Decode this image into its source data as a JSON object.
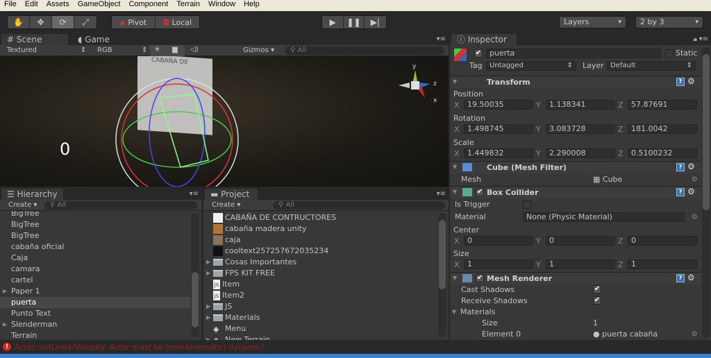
{
  "menu": [
    "File",
    "Edit",
    "Assets",
    "GameObject",
    "Component",
    "Terrain",
    "Window",
    "Help"
  ],
  "toolbar": {
    "tools": [
      "hand-icon",
      "move-icon",
      "rotate-icon",
      "scale-icon"
    ],
    "selected_tool": "rotate-icon",
    "pivot": "Pivot",
    "local": "Local",
    "layers": "Layers",
    "layout": "2 by 3"
  },
  "scene": {
    "tabs": [
      "Scene",
      "Game"
    ],
    "render_mode": "Textured",
    "color_mode": "RGB",
    "gizmos": "Gizmos",
    "search": "All",
    "overlay_text": "0",
    "sign_text": "CABAÑA DE",
    "gizmo_axes": [
      "y",
      "z",
      "x"
    ]
  },
  "hierarchy": {
    "tab": "Hierarchy",
    "create": "Create",
    "search": "All",
    "items": [
      {
        "label": "BigTree",
        "arrow": false
      },
      {
        "label": "BigTree",
        "arrow": false
      },
      {
        "label": "BigTree",
        "arrow": false
      },
      {
        "label": "cabaña oficial",
        "arrow": false
      },
      {
        "label": "Caja",
        "arrow": false
      },
      {
        "label": "camara",
        "arrow": false
      },
      {
        "label": "cartel",
        "arrow": false
      },
      {
        "label": "Paper 1",
        "arrow": true
      },
      {
        "label": "puerta",
        "arrow": false,
        "selected": true
      },
      {
        "label": "Punto Text",
        "arrow": false
      },
      {
        "label": "Slenderman",
        "arrow": true
      },
      {
        "label": "Terrain",
        "arrow": false
      }
    ]
  },
  "project": {
    "tab": "Project",
    "create": "Create",
    "search": "All",
    "items": [
      {
        "label": "CABAÑA DE CONTRUCTORES",
        "icon": "texture-icon",
        "color": "#f0f0f0"
      },
      {
        "label": "cabaña madera unity",
        "icon": "texture-icon",
        "color": "#b87333"
      },
      {
        "label": "caja",
        "icon": "texture-icon",
        "color": "#8b7355"
      },
      {
        "label": "cooltext257257672035234",
        "icon": "texture-icon",
        "color": "#111111"
      },
      {
        "label": "Cosas Importantes",
        "icon": "folder-icon",
        "arrow": true
      },
      {
        "label": "FPS KIT FREE",
        "icon": "folder-icon",
        "arrow": true
      },
      {
        "label": "Item",
        "icon": "js-script-icon"
      },
      {
        "label": "Item2",
        "icon": "js-script-icon"
      },
      {
        "label": "JS",
        "icon": "folder-icon",
        "arrow": true
      },
      {
        "label": "Materials",
        "icon": "folder-icon",
        "arrow": true
      },
      {
        "label": "Menu",
        "icon": "unity-scene-icon"
      },
      {
        "label": "New Terrain",
        "icon": "terrain-icon",
        "arrow": true
      }
    ]
  },
  "inspector": {
    "tab": "Inspector",
    "name": "puerta",
    "active": true,
    "static_label": "Static",
    "tag_label": "Tag",
    "tag": "Untagged",
    "layer_label": "Layer",
    "layer": "Default",
    "transform": {
      "title": "Transform",
      "position_label": "Position",
      "rotation_label": "Rotation",
      "scale_label": "Scale",
      "position": [
        "19.50035",
        "1.138341",
        "57.87691"
      ],
      "rotation": [
        "1.498745",
        "3.083728",
        "181.0042"
      ],
      "scale": [
        "1.449832",
        "2.290008",
        "0.5100232"
      ]
    },
    "axes": [
      "X",
      "Y",
      "Z"
    ],
    "mesh_filter": {
      "title": "Cube (Mesh Filter)",
      "mesh_label": "Mesh",
      "mesh": "Cube"
    },
    "box_collider": {
      "title": "Box Collider",
      "enabled": true,
      "is_trigger_label": "Is Trigger",
      "is_trigger": false,
      "material_label": "Material",
      "material": "None (Physic Material)",
      "center_label": "Center",
      "center": [
        "0",
        "0",
        "0"
      ],
      "size_label": "Size",
      "size": [
        "1",
        "1",
        "1"
      ]
    },
    "mesh_renderer": {
      "title": "Mesh Renderer",
      "enabled": true,
      "cast_label": "Cast Shadows",
      "cast": true,
      "receive_label": "Receive Shadows",
      "receive": true,
      "materials_label": "Materials",
      "size_label": "Size",
      "size": "1",
      "element_label": "Element 0",
      "element": "puerta cabaña"
    }
  },
  "status": {
    "message": "Actor::setLinearVelocity: Actor must be (non-kinematic) dynamic!",
    "color": "#a02020"
  }
}
